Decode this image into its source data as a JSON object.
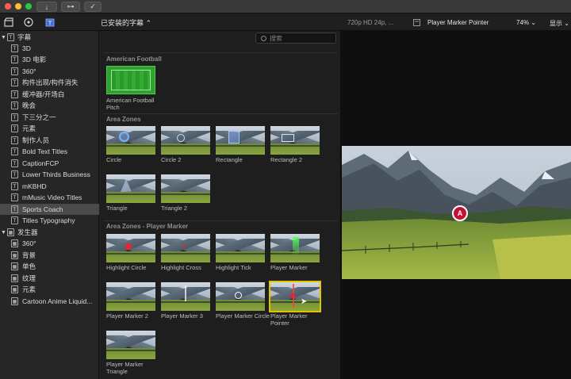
{
  "titlebar": {
    "import_label": "↓",
    "keywords_label": "⊶",
    "background_tasks_label": "✓"
  },
  "toolbar": {
    "library_select": "已安装的字幕 ⌃",
    "format_info": "720p HD 24p, ...",
    "clip_name": "Player Marker Pointer",
    "zoom": "74% ⌄",
    "view_menu": "显示 ⌄"
  },
  "search": {
    "placeholder": "搜索"
  },
  "sidebar": {
    "titles_group": "字幕",
    "title_items": [
      "3D",
      "3D 电影",
      "360°",
      "构件出现/构件消失",
      "缓冲器/开场白",
      "晚会",
      "下三分之一",
      "元素",
      "制作人员",
      "Bold Text Titles",
      "CaptionFCP",
      "Lower Thirds Business",
      "mKBHD",
      "mMusic Video Titles",
      "Sports Coach",
      "Titles Typography"
    ],
    "generators_group": "发生器",
    "generator_items": [
      "360°",
      "背景",
      "单色",
      "纹理",
      "元素",
      "Cartoon Anime Liquid..."
    ]
  },
  "browser": {
    "sections": [
      "American Football",
      "Area Zones",
      "Area Zones - Player Marker"
    ],
    "american_football": [
      "American Football Pitch"
    ],
    "area_zones": [
      "Circle",
      "Circle 2",
      "Rectangle",
      "Rectangle 2",
      "Triangle",
      "Triangle 2"
    ],
    "player_marker": [
      "Highlight Circle",
      "Highlight Cross",
      "Highlight Tick",
      "Player Marker",
      "Player Marker 2",
      "Player Marker 3",
      "Player Marker Circle",
      "Player Marker Pointer",
      "Player Marker Triangle"
    ]
  },
  "viewer": {
    "marker_letter": "A"
  }
}
